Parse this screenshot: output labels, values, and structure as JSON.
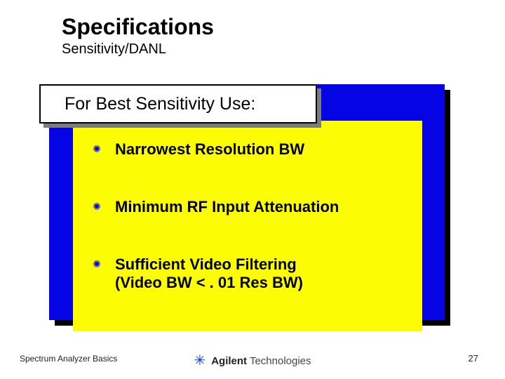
{
  "title": "Specifications",
  "subtitle": "Sensitivity/DANL",
  "callout": {
    "text": "For Best Sensitivity Use:"
  },
  "bullets": [
    {
      "text": "Narrowest Resolution BW"
    },
    {
      "text": "Minimum RF Input Attenuation"
    },
    {
      "text": "Sufficient Video Filtering\n(Video BW <  . 01 Res BW)"
    }
  ],
  "bullet_glyph": "✺",
  "footer": {
    "left": "Spectrum Analyzer Basics",
    "page": "27",
    "logo_burst": "✳",
    "logo_brand_bold": "Agilent",
    "logo_brand_rest": " Technologies"
  },
  "colors": {
    "blue_panel": "#0404e4",
    "yellow_panel": "#fcfc04"
  }
}
